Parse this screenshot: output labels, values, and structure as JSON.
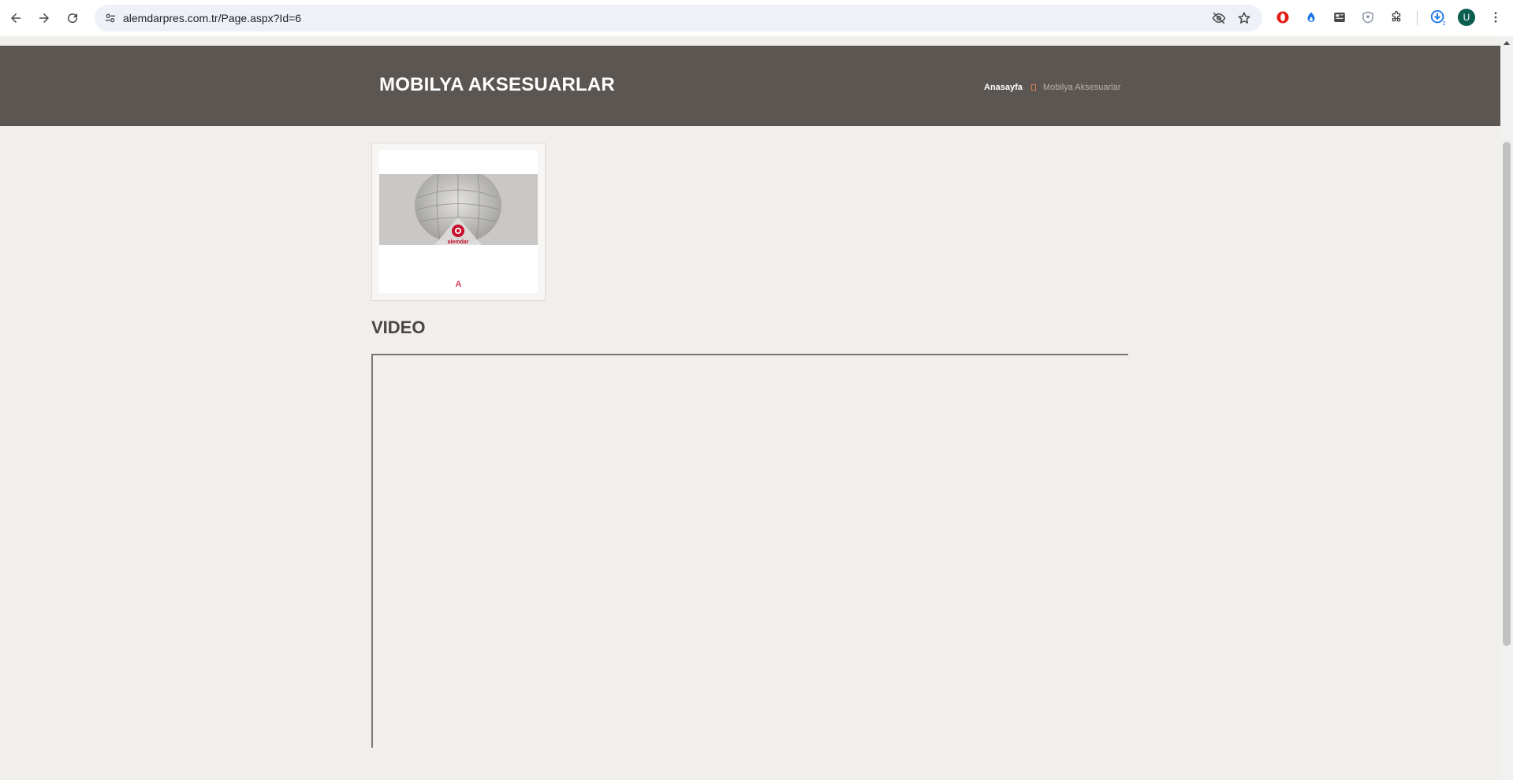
{
  "browser": {
    "url": "alemdarpres.com.tr/Page.aspx?Id=6",
    "avatar_letter": "U",
    "download_badge": "2",
    "icons": [
      "back-icon",
      "forward-icon",
      "reload-icon",
      "site-info-icon",
      "eye-off-icon",
      "star-icon",
      "opera-icon",
      "extension-flame-icon",
      "extension-sc-icon",
      "shield-icon",
      "puzzle-icon",
      "download-icon",
      "more-icon"
    ]
  },
  "page": {
    "banner_title": "MOBILYA AKSESUARLAR",
    "breadcrumb": {
      "home": "Anasayfa",
      "current": "Mobilya Aksesuarlar"
    },
    "card": {
      "caption": "A",
      "logo_text": "alemdar"
    },
    "video_title": "VIDEO"
  },
  "colors": {
    "banner": "#5c5652",
    "page_bg": "#f0efeb",
    "accent": "#d33b55"
  }
}
